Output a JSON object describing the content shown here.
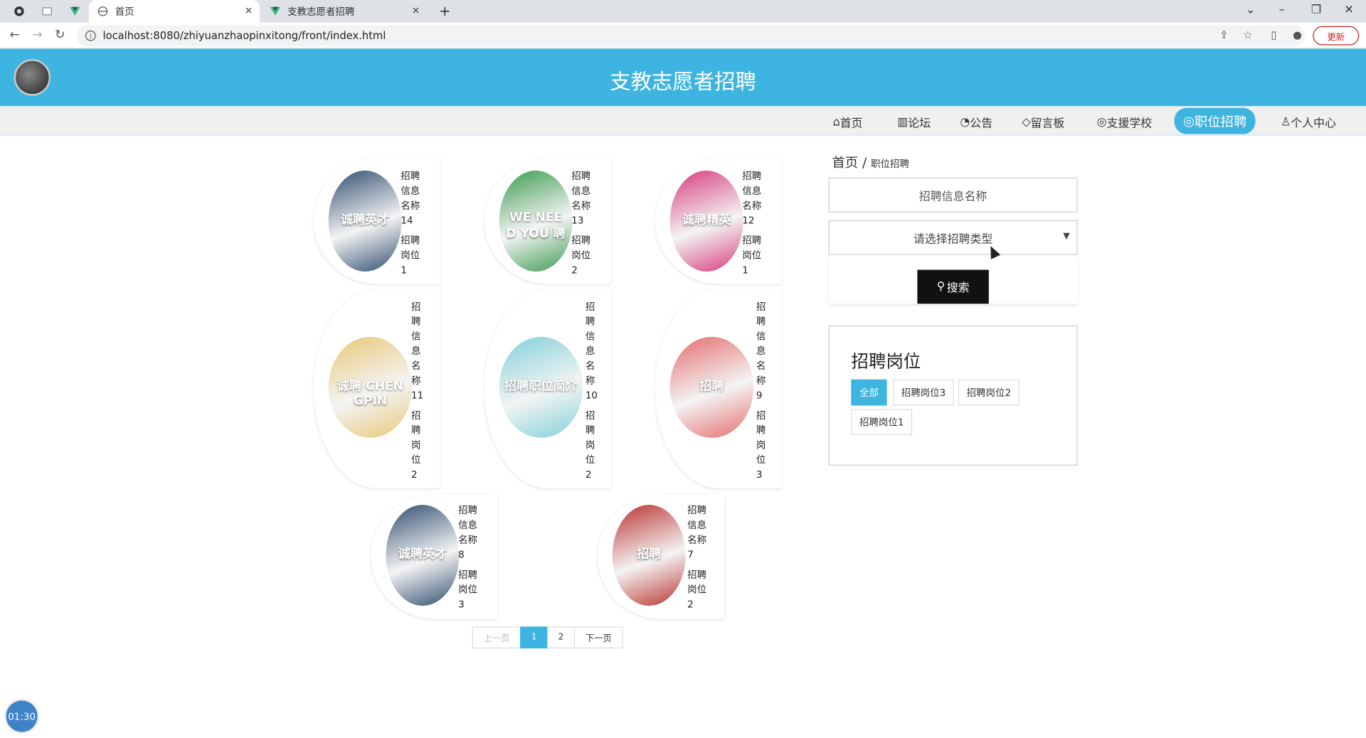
{
  "browser": {
    "tabs": [
      {
        "title": "",
        "icon": "github-icon"
      },
      {
        "title": "",
        "icon": "blank-page-icon"
      },
      {
        "title": "",
        "icon": "vue-icon"
      },
      {
        "title": "首页",
        "icon": "globe-icon"
      },
      {
        "title": "支教志愿者招聘",
        "icon": "vue-icon"
      }
    ],
    "url": "localhost:8080/zhiyuanzhaopinxitong/front/index.html",
    "update_label": "更新"
  },
  "site": {
    "title": "支教志愿者招聘"
  },
  "menu": [
    {
      "label": "首页",
      "icon": "home-icon"
    },
    {
      "label": "论坛",
      "icon": "forum-icon"
    },
    {
      "label": "公告",
      "icon": "power-icon"
    },
    {
      "label": "留言板",
      "icon": "tag-icon"
    },
    {
      "label": "支援学校",
      "icon": "globe-icon"
    },
    {
      "label": "职位招聘",
      "icon": "globe-icon"
    },
    {
      "label": "个人中心",
      "icon": "user-icon"
    }
  ],
  "breadcrumb": {
    "home": "首页",
    "sep": "/",
    "current": "职位招聘"
  },
  "search": {
    "name_placeholder": "招聘信息名称",
    "type_placeholder": "请选择招聘类型",
    "button_label": "搜索"
  },
  "categories": {
    "title": "招聘岗位",
    "tags": [
      "全部",
      "招聘岗位3",
      "招聘岗位2",
      "招聘岗位1"
    ]
  },
  "jobs": [
    {
      "name": "招聘信息名称14",
      "post": "招聘岗位1",
      "poster": "诚聘英才",
      "color": "#2f4d6e"
    },
    {
      "name": "招聘信息名称13",
      "post": "招聘岗位2",
      "poster": "WE NEED YOU 聘",
      "color": "#3a9a4e"
    },
    {
      "name": "招聘信息名称12",
      "post": "招聘岗位1",
      "poster": "诚聘精英",
      "color": "#d73a7a"
    },
    {
      "name": "招聘信息名称11",
      "post": "招聘岗位2",
      "poster": "诚聘 CHENGPIN",
      "color": "#e8c877"
    },
    {
      "name": "招聘信息名称10",
      "post": "招聘岗位2",
      "poster": "招聘职位简介",
      "color": "#7fd0d8"
    },
    {
      "name": "招聘信息名称9",
      "post": "招聘岗位3",
      "poster": "招聘",
      "color": "#e56b6b"
    },
    {
      "name": "招聘信息名称8",
      "post": "招聘岗位3",
      "poster": "诚聘英才",
      "color": "#2f4d6e"
    },
    {
      "name": "招聘信息名称7",
      "post": "招聘岗位2",
      "poster": "招聘",
      "color": "#b8322e"
    }
  ],
  "pagination": {
    "prev": "上一页",
    "pages": [
      "1",
      "2"
    ],
    "next": "下一页",
    "current": "1"
  },
  "timer": "01:30"
}
